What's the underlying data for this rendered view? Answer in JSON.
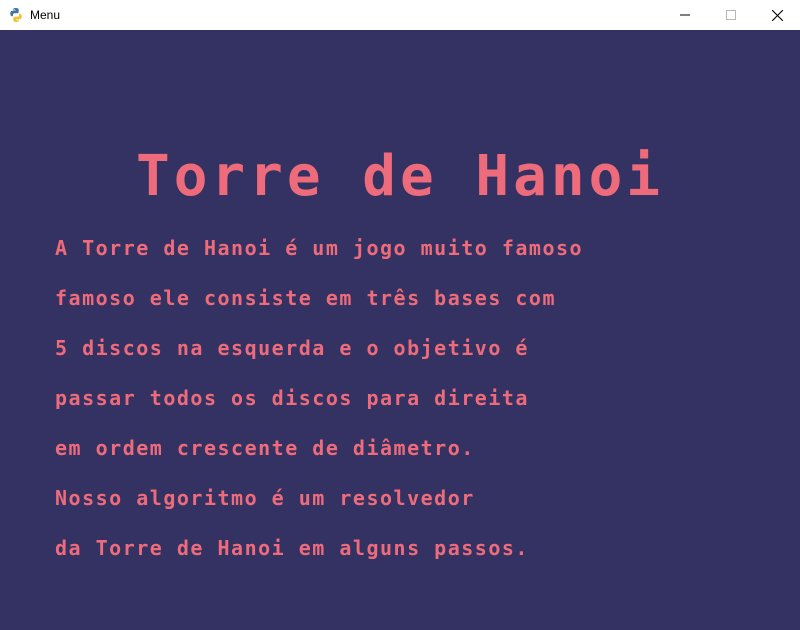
{
  "window": {
    "title": "Menu",
    "icon": "python-icon",
    "controls": [
      "minimize-icon",
      "maximize-icon",
      "close-icon"
    ]
  },
  "game": {
    "title": "Torre de Hanoi",
    "description": [
      "A Torre de Hanoi é um jogo muito famoso",
      "famoso ele consiste em três bases com",
      "5 discos na esquerda e o objetivo é",
      "passar todos os discos para direita",
      "em ordem crescente de diâmetro.",
      "Nosso algoritmo é um resolvedor",
      "da Torre de Hanoi em alguns passos."
    ]
  },
  "colors": {
    "background": "#333262",
    "text": "#ee6b7b",
    "titlebar": "#ffffff"
  }
}
